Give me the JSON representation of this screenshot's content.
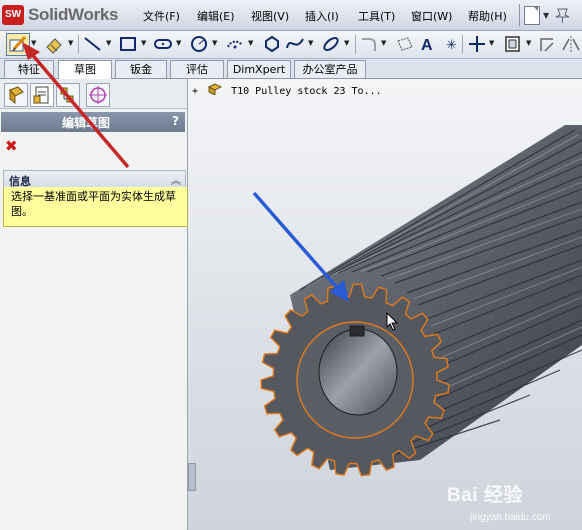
{
  "app": {
    "logo_badge": "SW",
    "logo_text": "SolidWorks"
  },
  "menubar": {
    "items": [
      "文件(F)",
      "编辑(E)",
      "视图(V)",
      "插入(I)",
      "工具(T)",
      "窗口(W)",
      "帮助(H)"
    ]
  },
  "command_tabs": [
    "特征",
    "草图",
    "钣金",
    "评估",
    "DimXpert",
    "办公室产品"
  ],
  "active_tab": "草图",
  "property_manager": {
    "title": "编辑草图",
    "help": "?",
    "cancel_icon": "close-icon",
    "info_title": "信息",
    "info_collapse_icon": "double-chevron-up-icon",
    "info_text": "选择一基准面或平面为实体生成草图。"
  },
  "feature_tree": {
    "expander": "+",
    "root_label": "T10 Pulley stock 23 To..."
  },
  "watermark": {
    "text": "Bai 经验",
    "url": "jingyan.baidu.com"
  },
  "colors": {
    "annotation_red": "#c62828",
    "annotation_blue": "#2a5bd7",
    "info_bg": "#ffff9e",
    "edge_orange": "#e07b1d"
  }
}
